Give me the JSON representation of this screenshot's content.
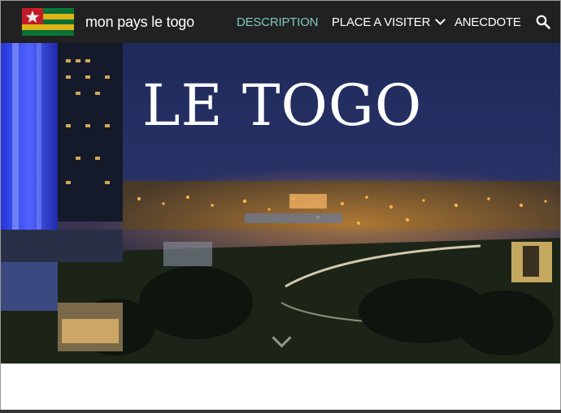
{
  "site": {
    "title": "mon pays le togo",
    "logo": "togo-flag-icon"
  },
  "nav": {
    "items": [
      {
        "label": "DESCRIPTION",
        "active": true
      },
      {
        "label": "PLACE A VISITER",
        "has_dropdown": true
      },
      {
        "label": "ANECDOTE"
      }
    ],
    "search_icon": "search-icon",
    "active_color": "#7fc8c4"
  },
  "hero": {
    "title": "LE TOGO",
    "scroll_icon": "chevron-down-icon"
  },
  "colors": {
    "navbar": "#212121",
    "sky": "#1b2450"
  }
}
